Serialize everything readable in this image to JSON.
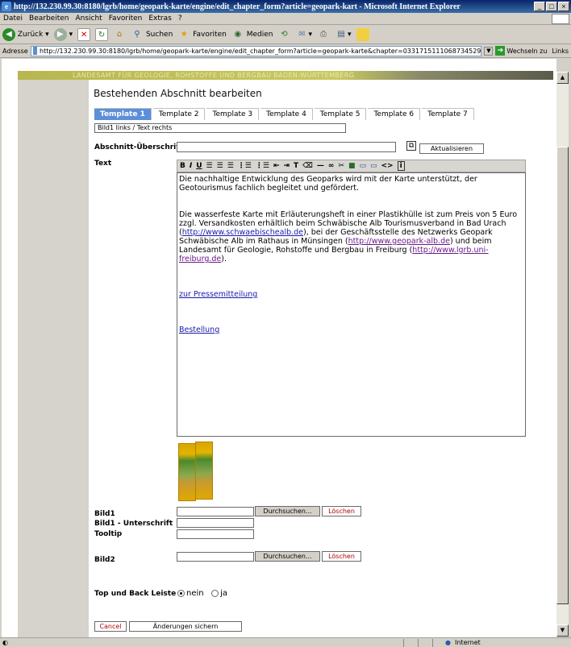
{
  "window": {
    "title": "http://132.230.99.30:8180/lgrb/home/geopark-karte/engine/edit_chapter_form?article=geopark-kart - Microsoft Internet Explorer"
  },
  "menu": [
    "Datei",
    "Bearbeiten",
    "Ansicht",
    "Favoriten",
    "Extras",
    "?"
  ],
  "toolbar": {
    "back": "Zurück",
    "search": "Suchen",
    "favorites": "Favoriten",
    "media": "Medien"
  },
  "address": {
    "label": "Adresse",
    "url": "http://132.230.99.30:8180/lgrb/home/geopark-karte/engine/edit_chapter_form?article=geopark-karte&chapter=0331715111068734529",
    "go": "Wechseln zu",
    "links": "Links"
  },
  "banner": "LANDESAMT FÜR GEOLOGIE, ROHSTOFFE UND BERGBAU BADEN-WÜRTTEMBERG",
  "page": {
    "heading": "Bestehenden Abschnitt bearbeiten"
  },
  "tabs": [
    "Template 1",
    "Template 2",
    "Template 3",
    "Template 4",
    "Template 5",
    "Template 6",
    "Template 7"
  ],
  "template_desc": "Bild1 links / Text rechts",
  "form": {
    "heading_label": "Abschnitt-Überschrift",
    "update_btn": "Aktualisieren",
    "text_label": "Text",
    "bild1_label": "Bild1",
    "bild1_caption_label": "Bild1 - Unterschrift",
    "tooltip_label": "Tooltip",
    "bild2_label": "Bild2",
    "browse_btn": "Durchsuchen...",
    "delete_btn": "Löschen",
    "topback_label": "Top und Back Leiste",
    "opt_no": "nein",
    "opt_yes": "ja",
    "cancel_btn": "Cancel",
    "save_btn": "Änderungen sichern"
  },
  "editor": {
    "p1": "Die nachhaltige Entwicklung des Geoparks wird mit der Karte unterstützt, der Geotourismus fachlich begleitet und gefördert.",
    "p2a": "Die wasserfeste Karte mit Erläuterungsheft in einer Plastikhülle ist zum Preis von 5 Euro zzgl. Versandkosten erhältlich beim Schwäbische Alb Tourismusverband in Bad Urach (",
    "link1": "http://www.schwaebischealb.de",
    "p2b": "), bei der Geschäftsstelle des Netzwerks Geopark Schwäbische Alb im Rathaus in Münsingen (",
    "link2": "http://www.geopark-alb.de",
    "p2c": ") und beim Landesamt für Geologie, Rohstoffe und Bergbau in Freiburg (",
    "link3": "http://www.lgrb.uni-freiburg.de",
    "p2d": ").",
    "link4": "zur Pressemitteilung",
    "link5": "Bestellung"
  },
  "status": {
    "zone": "Internet"
  }
}
